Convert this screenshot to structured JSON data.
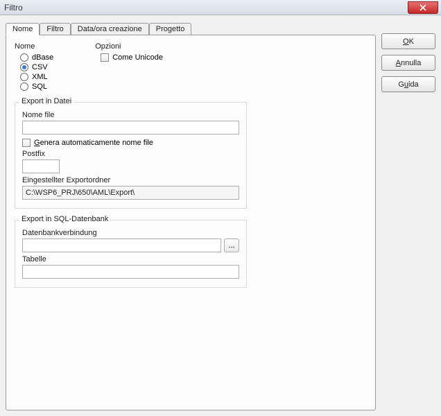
{
  "window": {
    "title": "Filtro"
  },
  "tabs": {
    "nome": "Nome",
    "filtro": "Filtro",
    "data": "Data/ora creazione",
    "progetto": "Progetto"
  },
  "nome_group": {
    "label": "Nome",
    "opt_dbase": "dBase",
    "opt_csv": "CSV",
    "opt_xml": "XML",
    "opt_sql": "SQL"
  },
  "opzioni_group": {
    "label": "Opzioni",
    "come_unicode": "Come Unicode"
  },
  "export_datei": {
    "legend": "Export in Datei",
    "nome_file_label": "Nome file",
    "nome_file_value": "",
    "auto_gen": "Genera automaticamente nome file",
    "postfix_label": "Postfix",
    "postfix_value": "",
    "folder_label": "Eingestellter Exportordner",
    "folder_value": "C:\\WSP6_PRJ\\650\\AML\\Export\\"
  },
  "export_sql": {
    "legend": "Export in SQL-Datenbank",
    "db_label": "Datenbankverbindung",
    "db_value": "",
    "browse": "...",
    "tabelle_label": "Tabelle",
    "tabelle_value": ""
  },
  "buttons": {
    "ok_pre": "",
    "ok_u": "O",
    "ok_post": "K",
    "annulla_pre": "",
    "annulla_u": "A",
    "annulla_post": "nnulla",
    "guida_pre": "G",
    "guida_u": "u",
    "guida_post": "ida"
  }
}
